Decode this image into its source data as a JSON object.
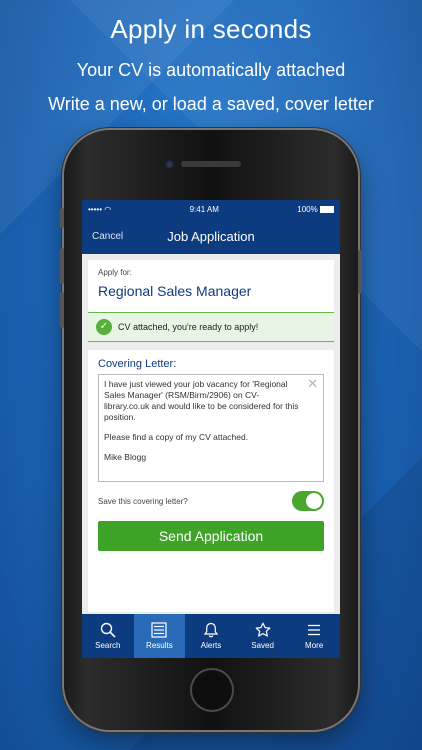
{
  "promo": {
    "headline": "Apply in seconds",
    "line1": "Your CV is automatically attached",
    "line2": "Write a new, or load a saved, cover letter"
  },
  "status": {
    "carrier": "•••••",
    "time": "9:41 AM",
    "battery": "100%"
  },
  "nav": {
    "cancel_label": "Cancel",
    "title": "Job Application"
  },
  "apply": {
    "label": "Apply for:",
    "job_title": "Regional Sales Manager"
  },
  "cv_banner": {
    "text": "CV attached, you're ready to apply!"
  },
  "letter": {
    "label": "Covering Letter:",
    "paragraph1": "I have just viewed your job vacancy for 'Regional Sales Manager' (RSM/Birm/2906) on CV-library.co.uk and would like to be considered for this position.",
    "paragraph2": "Please find a copy of my CV attached.",
    "signature": "Mike Blogg"
  },
  "save": {
    "label": "Save this covering letter?",
    "enabled": true
  },
  "send_button": "Send Application",
  "tabs": [
    {
      "label": "Search",
      "icon": "search-icon"
    },
    {
      "label": "Results",
      "icon": "results-icon",
      "active": true
    },
    {
      "label": "Alerts",
      "icon": "bell-icon"
    },
    {
      "label": "Saved",
      "icon": "star-icon"
    },
    {
      "label": "More",
      "icon": "menu-icon"
    }
  ],
  "colors": {
    "brand": "#0d3b80",
    "accent_green": "#3fa327",
    "background": "#1d67b8"
  }
}
